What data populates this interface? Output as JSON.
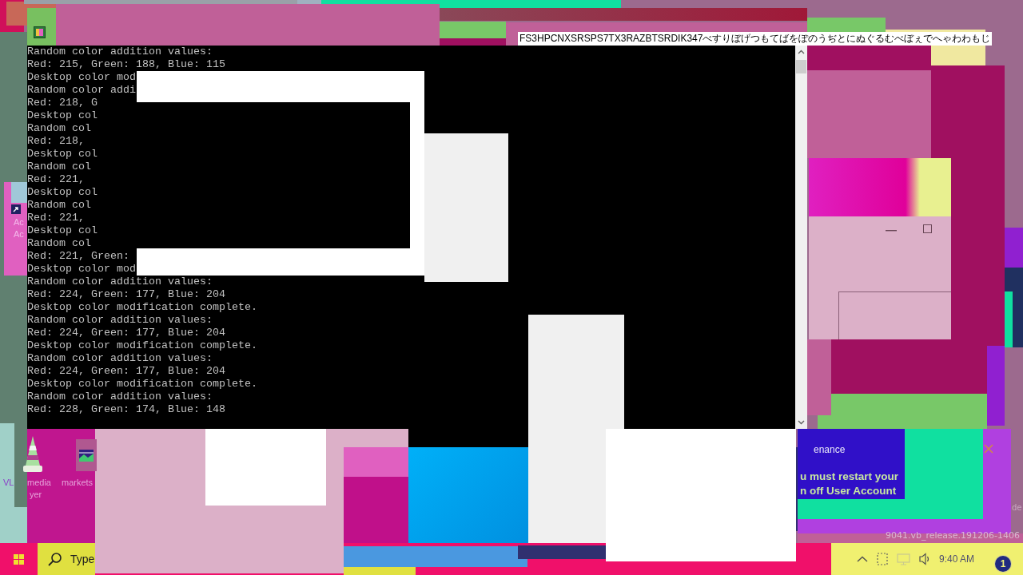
{
  "console_window": {
    "lines": [
      "Random color addition values:",
      "Red: 215, Green: 188, Blue: 115",
      "Desktop color mod",
      "Random color addi",
      "Red: 218, G",
      "Desktop col",
      "Random col",
      "Red: 218,",
      "Desktop col",
      "Random col",
      "Red: 221,",
      "Desktop col",
      "Random col",
      "Red: 221,",
      "Desktop col",
      "Random col",
      "Red: 221, Green:",
      "Desktop color mod",
      "Random color addition values:",
      "Red: 224, Green: 177, Blue: 204",
      "Desktop color modification complete.",
      "Random color addition values:",
      "Red: 224, Green: 177, Blue: 204",
      "Desktop color modification complete.",
      "Random color addition values:",
      "Red: 224, Green: 177, Blue: 204",
      "Desktop color modification complete.",
      "Random color addition values:",
      "Red: 228, Green: 174, Blue: 148"
    ]
  },
  "garbled_title": "FS3HPCNXSRSPS7TX3RAZBTSRDIK347べすりぼげつもてばをぽのうぢとにぬぐるむべぼぇでへゃわわもじ",
  "desktop_icons": [
    {
      "kind": "shortcut",
      "labels": [
        "Ac",
        "Ac"
      ]
    },
    {
      "kind": "cone",
      "labels": [
        "VL",
        "media",
        "yer"
      ]
    },
    {
      "kind": "picture",
      "labels": [
        "markets"
      ]
    }
  ],
  "notification": {
    "title": "enance",
    "lines": [
      "u must restart your",
      "n off User Account"
    ]
  },
  "edge_text": "de",
  "build_text": "9041.vb_release.191206-1406",
  "taskbar": {
    "search": {
      "placeholder": "Type"
    },
    "clock": "9:40 AM",
    "badge": "1"
  }
}
